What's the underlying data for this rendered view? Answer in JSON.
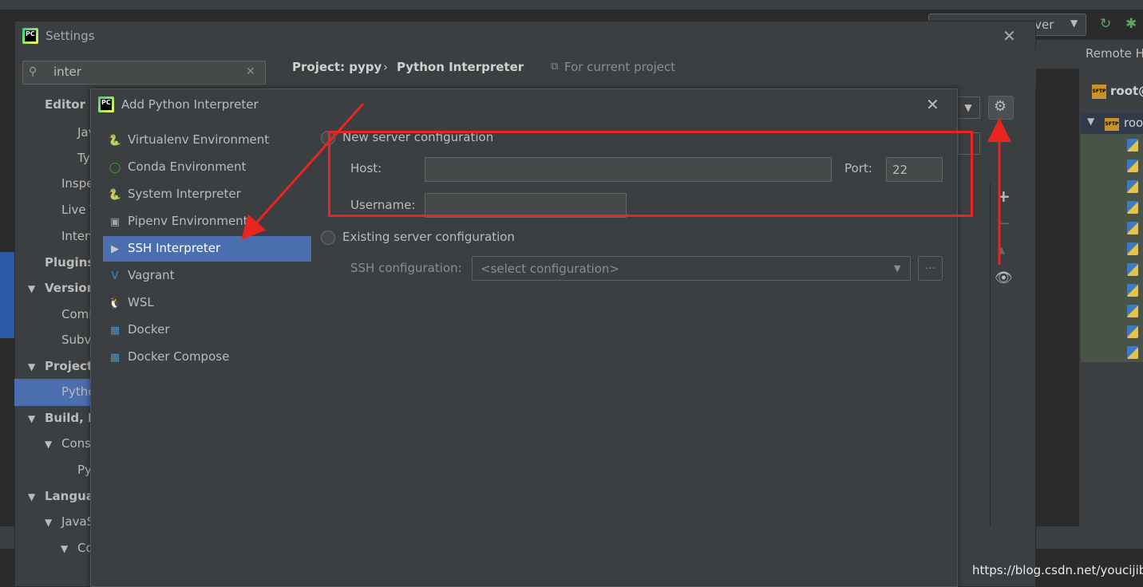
{
  "ide": {
    "remote_panel_title": "Remote H",
    "server_combo_label": "rver",
    "remote_root_label": "root@",
    "remote_root_folder": "roo"
  },
  "settings": {
    "title": "Settings",
    "search_value": "inter",
    "tree": [
      {
        "label": "Editor",
        "bold": true
      },
      {
        "label": "Jav",
        "bold": false
      },
      {
        "label": "Ty",
        "bold": false
      },
      {
        "label": "Inspe",
        "bold": false
      },
      {
        "label": "Live T",
        "bold": false
      },
      {
        "label": "Inten",
        "bold": false
      },
      {
        "label": "Plugins",
        "bold": true
      },
      {
        "label": "Version",
        "bold": true
      },
      {
        "label": "Comi",
        "bold": false
      },
      {
        "label": "Subv",
        "bold": false
      },
      {
        "label": "Project:",
        "bold": true
      },
      {
        "label": "Pytho",
        "bold": false
      },
      {
        "label": "Build, E",
        "bold": true
      },
      {
        "label": "Cons",
        "bold": false
      },
      {
        "label": "Py",
        "bold": false
      },
      {
        "label": "Langua",
        "bold": true
      },
      {
        "label": "JavaS",
        "bold": false
      },
      {
        "label": "Co",
        "bold": false
      }
    ],
    "breadcrumb": {
      "project": "Project: pypy",
      "separator": "›",
      "page": "Python Interpreter"
    },
    "for_current_project": "For current project"
  },
  "add_dialog": {
    "title": "Add Python Interpreter",
    "options": [
      {
        "label": "Virtualenv Environment",
        "icon": "python-icon"
      },
      {
        "label": "Conda Environment",
        "icon": "conda-icon"
      },
      {
        "label": "System Interpreter",
        "icon": "python-icon"
      },
      {
        "label": "Pipenv Environment",
        "icon": "pipenv-icon"
      },
      {
        "label": "SSH Interpreter",
        "icon": "ssh-terminal-icon"
      },
      {
        "label": "Vagrant",
        "icon": "vagrant-icon"
      },
      {
        "label": "WSL",
        "icon": "linux-icon"
      },
      {
        "label": "Docker",
        "icon": "docker-icon"
      },
      {
        "label": "Docker Compose",
        "icon": "docker-icon"
      }
    ],
    "selected_option": "SSH Interpreter",
    "new_server": {
      "label": "New server configuration",
      "host_label": "Host:",
      "host_value": "",
      "port_label": "Port:",
      "port_value": "22",
      "username_label": "Username:",
      "username_value": ""
    },
    "existing_server": {
      "label": "Existing server configuration",
      "ssh_config_label": "SSH configuration:",
      "ssh_config_placeholder": "<select configuration>",
      "browse_label": "..."
    }
  },
  "watermark": "https://blog.csdn.net/youcijibi",
  "colors": {
    "annotation_red": "#e8261f",
    "selection_blue": "#4b6eaf"
  }
}
